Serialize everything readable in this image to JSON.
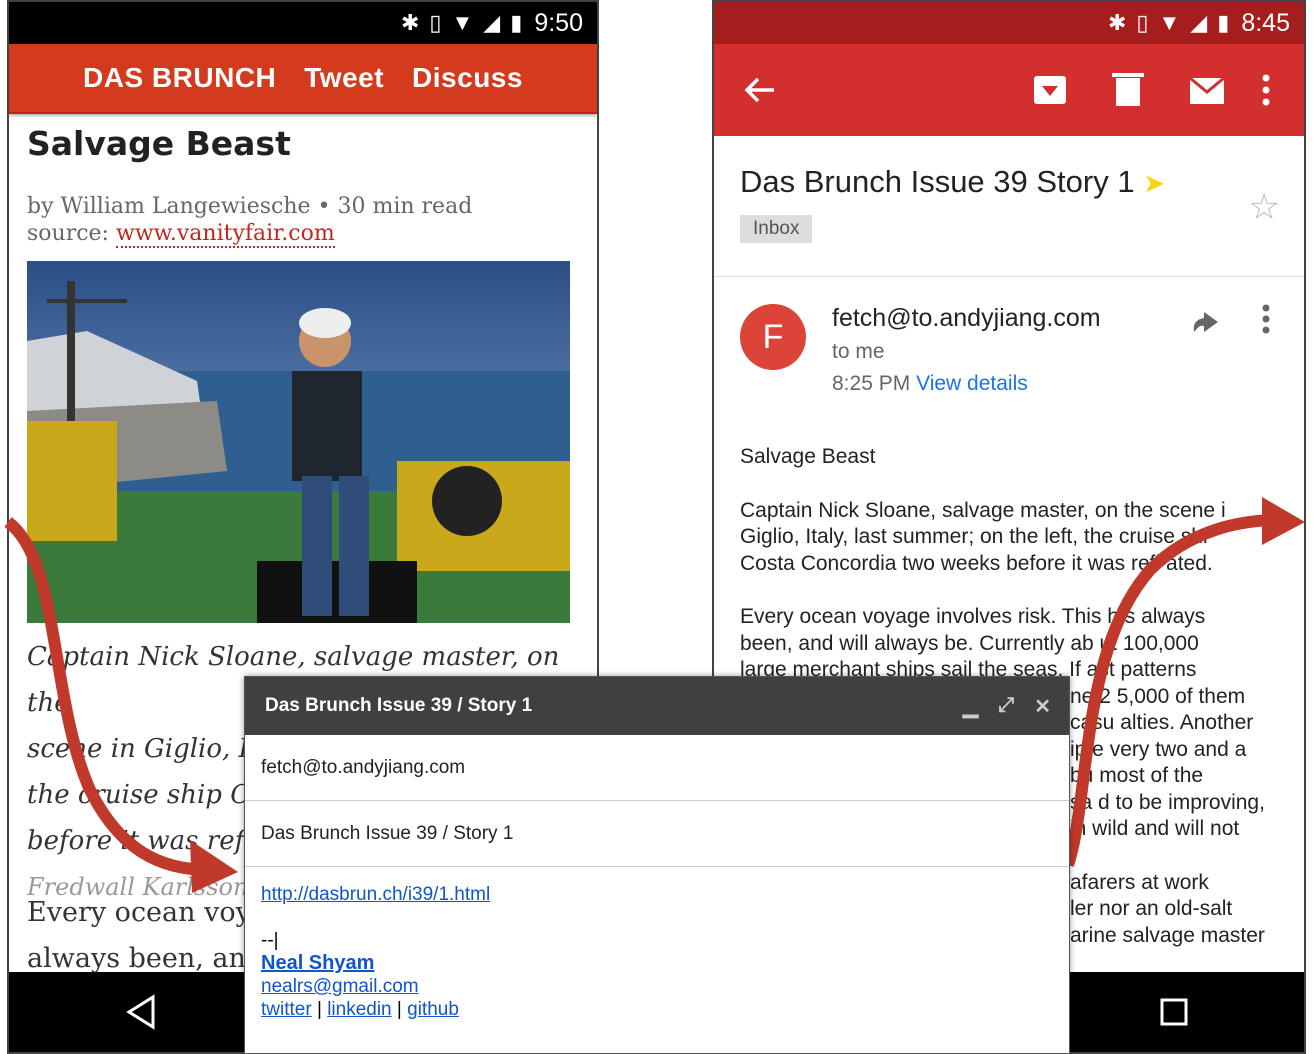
{
  "left_phone": {
    "status_time": "9:50",
    "appbar": {
      "brand": "DAS BRUNCH",
      "tweet": "Tweet",
      "discuss": "Discuss"
    },
    "article": {
      "title": "Salvage Beast",
      "byline": "by William Langewiesche • 30 min read",
      "source_label": "source:",
      "source_link": "www.vanityfair.com",
      "caption_lines": [
        "Captain Nick Sloane, salvage master, on the",
        "scene in Giglio, Ita",
        "the cruise ship Cos",
        "before it was reflo"
      ],
      "credit": "Fredwall Karlsson",
      "body_lines": [
        "Every ocean voya",
        "always been, and"
      ]
    }
  },
  "right_phone": {
    "status_time": "8:45",
    "subject": "Das Brunch Issue 39 Story 1",
    "label": "Inbox",
    "sender_initial": "F",
    "sender": "fetch@to.andyjiang.com",
    "recipient": "to me",
    "time": "8:25 PM",
    "view_details": "View details",
    "body": {
      "heading": "Salvage Beast",
      "p1": [
        "Captain Nick Sloane, salvage master, on the scene i",
        "Giglio, Italy, last summer; on the left, the cruise shi",
        "Costa Concordia two weeks before it was refl ated."
      ],
      "p2": [
        "Every ocean voyage involves risk. This h s always",
        "been, and will always be. Currently ab ut 100,000",
        "large merchant ships sail the seas. If ast patterns",
        "ne 2 5,000 of them",
        "casu alties. Another",
        "ip e very two and a",
        "bu most of the",
        "sa d to be improving,",
        "in wild and will not"
      ],
      "p3": [
        "afarers at work",
        "ler nor an old-salt",
        "arine salvage master"
      ]
    }
  },
  "compose": {
    "title": "Das Brunch Issue 39 / Story 1",
    "to": "fetch@to.andyjiang.com",
    "subject": "Das Brunch Issue 39 / Story 1",
    "link": "http://dasbrun.ch/i39/1.html",
    "sig_sep": "--",
    "sig_name": "Neal Shyam",
    "sig_email": "nealrs@gmail.com",
    "sig_links": [
      "twitter",
      "linkedin",
      "github"
    ],
    "sig_sep_char": "|"
  },
  "colors": {
    "dasbrunch_red": "#d33a1e",
    "gmail_red": "#d32f2f",
    "arrow": "#c0392b"
  }
}
